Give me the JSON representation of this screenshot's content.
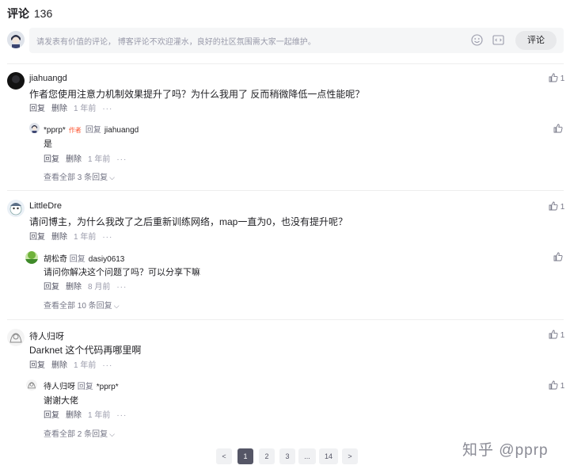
{
  "header": {
    "title": "评论",
    "count": "136"
  },
  "composer": {
    "placeholder": "请发表有价值的评论， 博客评论不欢迎灌水，良好的社区氛围需大家一起维护。",
    "submit_label": "评论"
  },
  "comments": [
    {
      "user": "jiahuangd",
      "text": "作者您使用注意力机制效果提升了吗？为什么我用了 反而稍微降低一点性能呢？",
      "reply_label": "回复",
      "delete_label": "删除",
      "time": "1 年前",
      "likes": "1",
      "reply": {
        "user": "*pprp*",
        "author_tag": "作者",
        "reply_word": "回复",
        "reply_to": "jiahuangd",
        "text": "是",
        "reply_label": "回复",
        "delete_label": "删除",
        "time": "1 年前",
        "likes": ""
      },
      "view_all": "查看全部 3 条回复"
    },
    {
      "user": "LittleDre",
      "text": "请问博主，为什么我改了之后重新训练网络，map一直为0，也没有提升呢？",
      "reply_label": "回复",
      "delete_label": "删除",
      "time": "1 年前",
      "likes": "1",
      "reply": {
        "user": "胡松奇",
        "reply_word": "回复",
        "reply_to": "dasiy0613",
        "text": "请问你解决这个问题了吗？可以分享下嘛",
        "reply_label": "回复",
        "delete_label": "删除",
        "time": "8 月前",
        "likes": ""
      },
      "view_all": "查看全部 10 条回复"
    },
    {
      "user": "待人归呀",
      "text": "Darknet 这个代码再哪里啊",
      "reply_label": "回复",
      "delete_label": "删除",
      "time": "1 年前",
      "likes": "1",
      "reply": {
        "user": "待人归呀",
        "reply_word": "回复",
        "reply_to": "*pprp*",
        "text": "谢谢大佬",
        "reply_label": "回复",
        "delete_label": "删除",
        "time": "1 年前",
        "likes": "1"
      },
      "view_all": "查看全部 2 条回复"
    }
  ],
  "pagination": {
    "prev": "<",
    "pages": [
      "1",
      "2",
      "3",
      "...",
      "14"
    ],
    "next": ">",
    "current": "1"
  },
  "watermark": "知乎 @pprp",
  "more_glyph": "···",
  "icons": {
    "like": "thumbs-up-icon",
    "emoji": "emoji-icon",
    "code": "code-icon",
    "chevron": "chevron-down-icon"
  },
  "colors": {
    "accent_tag": "#fc5531",
    "active_page": "#555666"
  }
}
